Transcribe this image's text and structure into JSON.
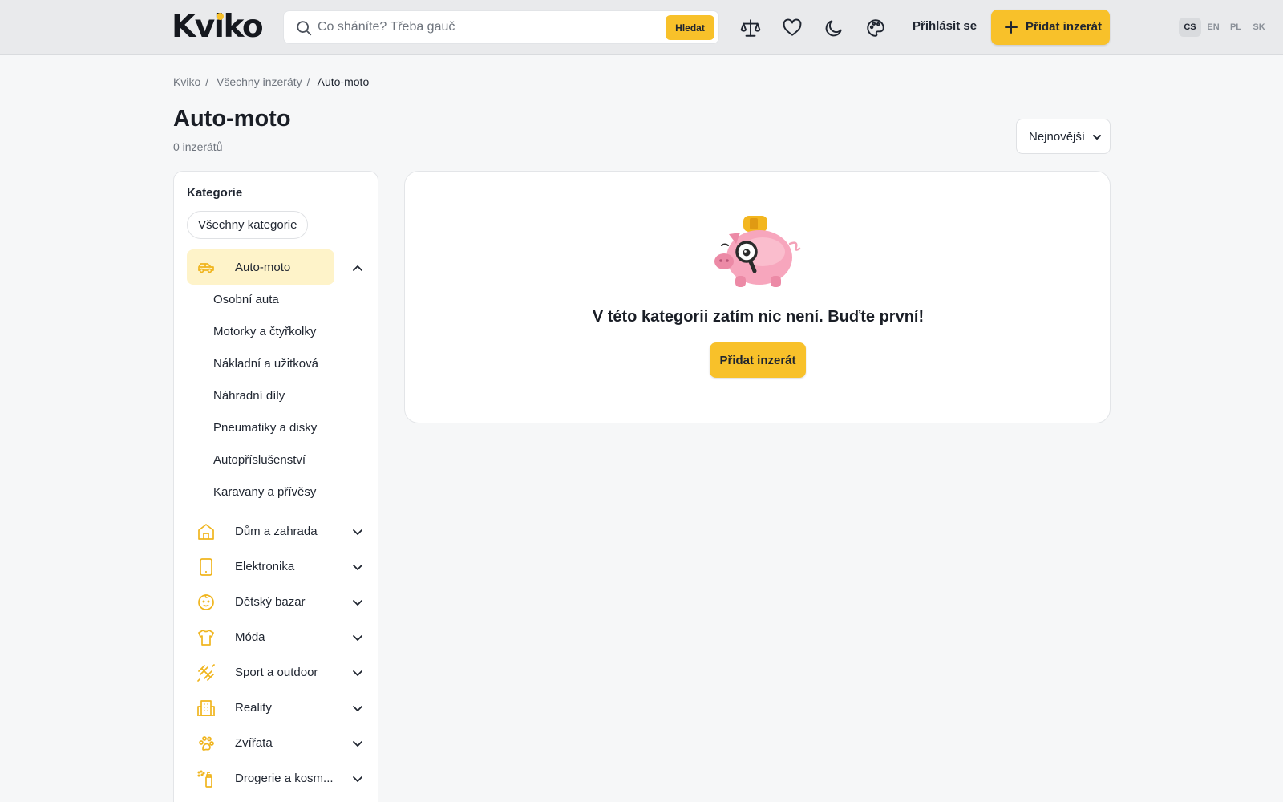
{
  "header": {
    "logo": "Kviko",
    "search_placeholder": "Co sháníte? Třeba gauč",
    "search_button": "Hledat",
    "login": "Přihlásit se",
    "add_listing": "Přidat inzerát",
    "languages": [
      "CS",
      "EN",
      "PL",
      "SK"
    ],
    "active_language": "CS",
    "accent_color": "#f8c12a"
  },
  "breadcrumb": [
    "Kviko",
    "Všechny inzeráty",
    "Auto-moto"
  ],
  "page": {
    "title": "Auto-moto",
    "count": "0 inzerátů",
    "sort_selected": "Nejnovější"
  },
  "sidebar": {
    "title": "Kategorie",
    "all_categories": "Všechny kategorie",
    "active_category": "Auto-moto",
    "subcategories": [
      "Osobní auta",
      "Motorky a čtyřkolky",
      "Nákladní a užitková",
      "Náhradní díly",
      "Pneumatiky a disky",
      "Autopříslušenství",
      "Karavany a přívěsy"
    ],
    "categories": [
      {
        "label": "Dům a zahrada",
        "icon": "house-icon"
      },
      {
        "label": "Elektronika",
        "icon": "phone-icon"
      },
      {
        "label": "Dětský bazar",
        "icon": "baby-icon"
      },
      {
        "label": "Móda",
        "icon": "shirt-icon"
      },
      {
        "label": "Sport a outdoor",
        "icon": "dumbbell-icon"
      },
      {
        "label": "Reality",
        "icon": "building-icon"
      },
      {
        "label": "Zvířata",
        "icon": "paw-icon"
      },
      {
        "label": "Drogerie a kosm...",
        "icon": "spray-icon"
      }
    ]
  },
  "empty_state": {
    "message": "V této kategorii zatím nic není. Buďte první!",
    "button": "Přidat inzerát"
  }
}
